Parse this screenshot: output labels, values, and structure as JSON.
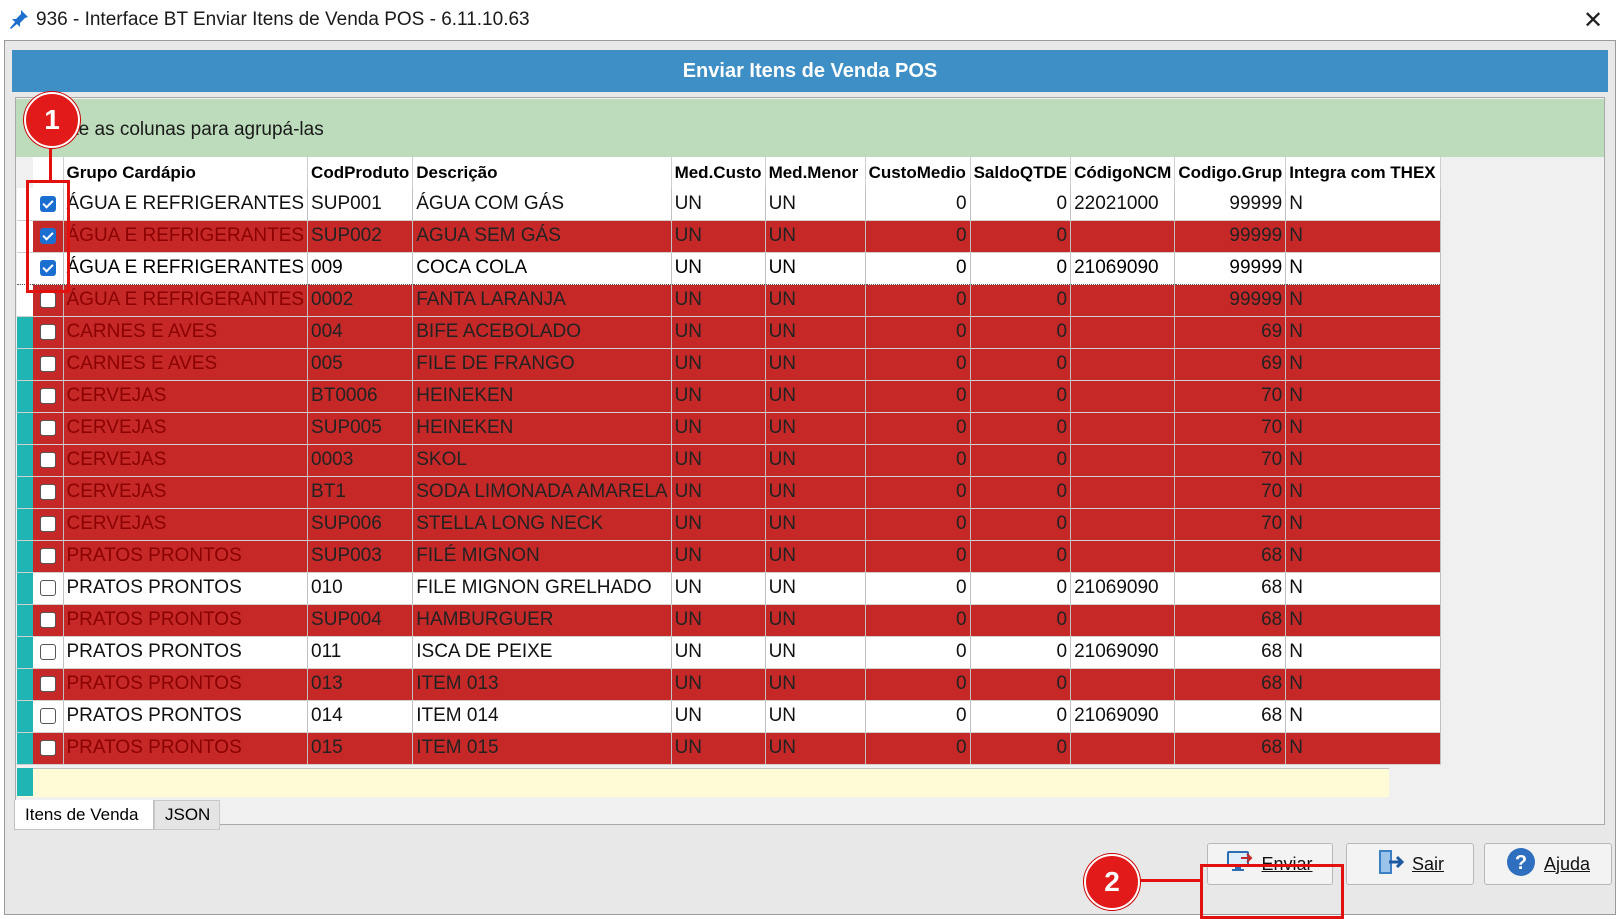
{
  "window": {
    "title": "936 - Interface BT Enviar Itens de Venda POS - 6.11.10.63",
    "close": "✕"
  },
  "header": {
    "title": "Enviar Itens de Venda POS"
  },
  "group_hint": "Arraste as colunas para agrupá-las",
  "columns": [
    "Grupo Cardápio",
    "CodProduto",
    "Descrição",
    "Med.Custo",
    "Med.Menor",
    "CustoMedio",
    "SaldoQTDE",
    "CódigoNCM",
    "Codigo.Grup",
    "Integra com THEX"
  ],
  "rows": [
    {
      "checked": true,
      "style": "white",
      "grupo": "ÁGUA E REFRIGERANTES",
      "cod": "SUP001",
      "desc": "ÁGUA COM GÁS",
      "medc": "UN",
      "medm": "UN",
      "custo": "0",
      "saldo": "0",
      "ncm": "22021000",
      "cgrup": "99999",
      "thex": "N"
    },
    {
      "checked": true,
      "style": "red",
      "grupo": "ÁGUA E REFRIGERANTES",
      "cod": "SUP002",
      "desc": "AGUA SEM GÁS",
      "medc": "UN",
      "medm": "UN",
      "custo": "0",
      "saldo": "0",
      "ncm": "",
      "cgrup": "99999",
      "thex": "N"
    },
    {
      "checked": true,
      "style": "focus",
      "grupo": "ÁGUA E REFRIGERANTES",
      "cod": "009",
      "desc": "COCA COLA",
      "medc": "UN",
      "medm": "UN",
      "custo": "0",
      "saldo": "0",
      "ncm": "21069090",
      "cgrup": "99999",
      "thex": "N"
    },
    {
      "checked": false,
      "style": "red",
      "grupo": "ÁGUA E REFRIGERANTES",
      "cod": "0002",
      "desc": "FANTA LARANJA",
      "medc": "UN",
      "medm": "UN",
      "custo": "0",
      "saldo": "0",
      "ncm": "",
      "cgrup": "99999",
      "thex": "N"
    },
    {
      "checked": false,
      "style": "red",
      "grupo": "CARNES E AVES",
      "cod": "004",
      "desc": "BIFE ACEBOLADO",
      "medc": "UN",
      "medm": "UN",
      "custo": "0",
      "saldo": "0",
      "ncm": "",
      "cgrup": "69",
      "thex": "N"
    },
    {
      "checked": false,
      "style": "red",
      "grupo": "CARNES E AVES",
      "cod": "005",
      "desc": "FILE DE FRANGO",
      "medc": "UN",
      "medm": "UN",
      "custo": "0",
      "saldo": "0",
      "ncm": "",
      "cgrup": "69",
      "thex": "N"
    },
    {
      "checked": false,
      "style": "red",
      "grupo": "CERVEJAS",
      "cod": "BT0006",
      "desc": "HEINEKEN",
      "medc": "UN",
      "medm": "UN",
      "custo": "0",
      "saldo": "0",
      "ncm": "",
      "cgrup": "70",
      "thex": "N"
    },
    {
      "checked": false,
      "style": "red",
      "grupo": "CERVEJAS",
      "cod": "SUP005",
      "desc": "HEINEKEN",
      "medc": "UN",
      "medm": "UN",
      "custo": "0",
      "saldo": "0",
      "ncm": "",
      "cgrup": "70",
      "thex": "N"
    },
    {
      "checked": false,
      "style": "red",
      "grupo": "CERVEJAS",
      "cod": "0003",
      "desc": "SKOL",
      "medc": "UN",
      "medm": "UN",
      "custo": "0",
      "saldo": "0",
      "ncm": "",
      "cgrup": "70",
      "thex": "N"
    },
    {
      "checked": false,
      "style": "red",
      "grupo": "CERVEJAS",
      "cod": "BT1",
      "desc": "SODA LIMONADA AMARELA",
      "medc": "UN",
      "medm": "UN",
      "custo": "0",
      "saldo": "0",
      "ncm": "",
      "cgrup": "70",
      "thex": "N"
    },
    {
      "checked": false,
      "style": "red",
      "grupo": "CERVEJAS",
      "cod": "SUP006",
      "desc": "STELLA LONG NECK",
      "medc": "UN",
      "medm": "UN",
      "custo": "0",
      "saldo": "0",
      "ncm": "",
      "cgrup": "70",
      "thex": "N"
    },
    {
      "checked": false,
      "style": "red",
      "grupo": "PRATOS PRONTOS",
      "cod": "SUP003",
      "desc": "FILÉ MIGNON",
      "medc": "UN",
      "medm": "UN",
      "custo": "0",
      "saldo": "0",
      "ncm": "",
      "cgrup": "68",
      "thex": "N"
    },
    {
      "checked": false,
      "style": "white",
      "grupo": "PRATOS PRONTOS",
      "cod": "010",
      "desc": "FILE MIGNON GRELHADO",
      "medc": "UN",
      "medm": "UN",
      "custo": "0",
      "saldo": "0",
      "ncm": "21069090",
      "cgrup": "68",
      "thex": "N"
    },
    {
      "checked": false,
      "style": "red",
      "grupo": "PRATOS PRONTOS",
      "cod": "SUP004",
      "desc": "HAMBURGUER",
      "medc": "UN",
      "medm": "UN",
      "custo": "0",
      "saldo": "0",
      "ncm": "",
      "cgrup": "68",
      "thex": "N"
    },
    {
      "checked": false,
      "style": "white",
      "grupo": "PRATOS PRONTOS",
      "cod": "011",
      "desc": "ISCA DE PEIXE",
      "medc": "UN",
      "medm": "UN",
      "custo": "0",
      "saldo": "0",
      "ncm": "21069090",
      "cgrup": "68",
      "thex": "N"
    },
    {
      "checked": false,
      "style": "red",
      "grupo": "PRATOS PRONTOS",
      "cod": "013",
      "desc": "ITEM 013",
      "medc": "UN",
      "medm": "UN",
      "custo": "0",
      "saldo": "0",
      "ncm": "",
      "cgrup": "68",
      "thex": "N"
    },
    {
      "checked": false,
      "style": "white",
      "grupo": "PRATOS PRONTOS",
      "cod": "014",
      "desc": "ITEM 014",
      "medc": "UN",
      "medm": "UN",
      "custo": "0",
      "saldo": "0",
      "ncm": "21069090",
      "cgrup": "68",
      "thex": "N"
    },
    {
      "checked": false,
      "style": "red",
      "grupo": "PRATOS PRONTOS",
      "cod": "015",
      "desc": "ITEM 015",
      "medc": "UN",
      "medm": "UN",
      "custo": "0",
      "saldo": "0",
      "ncm": "",
      "cgrup": "68",
      "thex": "N"
    }
  ],
  "tabs": [
    "Itens de Venda",
    "JSON"
  ],
  "buttons": {
    "enviar": "Enviar",
    "sair": "Sair",
    "ajuda": "Ajuda"
  },
  "annotations": {
    "one": "1",
    "two": "2"
  },
  "icons": {
    "pin": "pin-icon",
    "send": "computer-send-icon",
    "exit": "exit-door-icon",
    "help": "help-icon"
  },
  "colors": {
    "header": "#3d8fc6",
    "row_red": "#c62828",
    "group_area": "#bcdcbc",
    "indicator": "#20b5b5",
    "annotation": "#e31010"
  }
}
